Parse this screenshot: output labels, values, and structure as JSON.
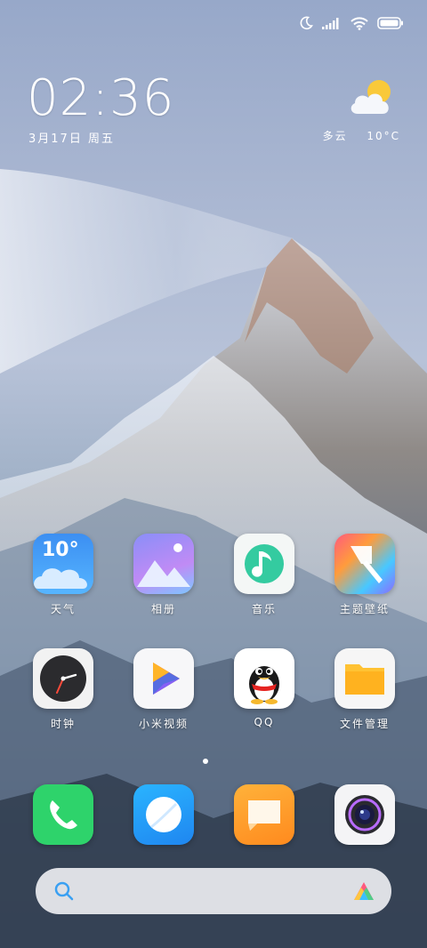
{
  "status_bar": {
    "icons": [
      "moon-icon",
      "signal-icon",
      "wifi-icon",
      "battery-icon"
    ]
  },
  "clock_widget": {
    "time": "02:36",
    "date": "3月17日 周五"
  },
  "weather_widget": {
    "condition": "多云",
    "temperature": "10°C",
    "icon": "partly-cloudy-icon"
  },
  "apps": [
    {
      "label": "天气",
      "icon": "weather-app-icon",
      "badge_text": "10°"
    },
    {
      "label": "相册",
      "icon": "gallery-app-icon"
    },
    {
      "label": "音乐",
      "icon": "music-app-icon"
    },
    {
      "label": "主题壁纸",
      "icon": "themes-app-icon"
    },
    {
      "label": "时钟",
      "icon": "clock-app-icon"
    },
    {
      "label": "小米视频",
      "icon": "mi-video-app-icon"
    },
    {
      "label": "QQ",
      "icon": "qq-app-icon"
    },
    {
      "label": "文件管理",
      "icon": "file-manager-app-icon"
    }
  ],
  "dock": [
    {
      "icon": "phone-app-icon"
    },
    {
      "icon": "browser-app-icon"
    },
    {
      "icon": "messages-app-icon"
    },
    {
      "icon": "camera-app-icon"
    }
  ],
  "search_bar": {
    "icon": "search-icon",
    "assistant_icon": "ai-assistant-icon"
  },
  "colors": {
    "weather_bg": "#3d9cf0",
    "phone_bg": "#2ed36b",
    "browser_bg": "#1f9af2",
    "messages_bg": "#ff9a2a",
    "files_bg": "#ffb21f"
  }
}
